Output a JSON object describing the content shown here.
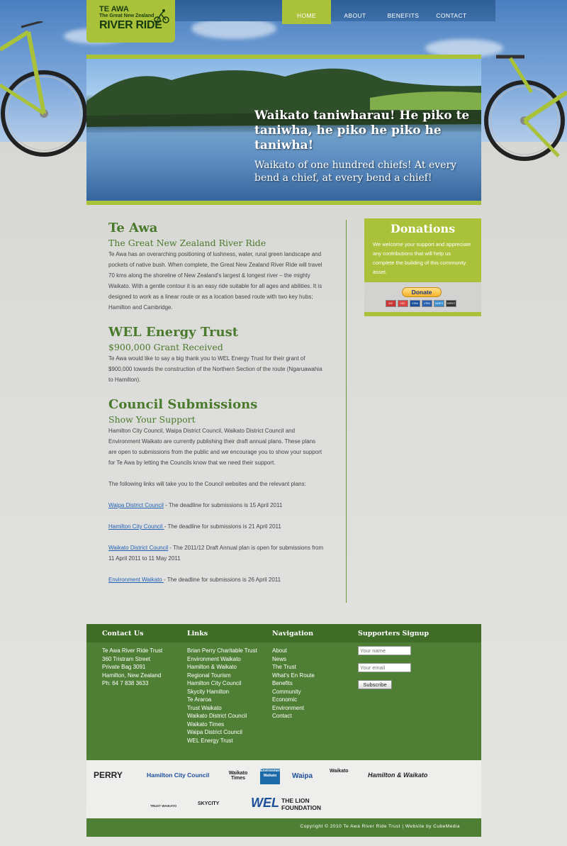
{
  "logo": {
    "line1": "TE AWA",
    "line2": "The Great New Zealand",
    "line3": "RIVER RIDE"
  },
  "nav": [
    {
      "label": "HOME",
      "active": true
    },
    {
      "label": "ABOUT",
      "active": false
    },
    {
      "label": "BENEFITS",
      "active": false
    },
    {
      "label": "CONTACT",
      "active": false
    }
  ],
  "banner": {
    "maori": "Waikato taniwharau! He piko te taniwha, he piko he piko he taniwha!",
    "english": "Waikato of one hundred chiefs! At every bend a chief, at every  bend a chief!"
  },
  "sections": {
    "teawa": {
      "title": "Te Awa",
      "subtitle": "The Great New Zealand River Ride",
      "body": "Te Awa has an overarching positioning of lushness, water, rural green landscape and pockets of native bush. When complete, the Great New Zealand River Ride will travel 70 kms along the shoreline of New Zealand's largest & longest river – the mighty Waikato. With a gentle contour it is an easy ride suitable for all ages and abilities. It is designed to work as a linear route or as a location based route with two key hubs; Hamilton and Cambridge."
    },
    "wel": {
      "title": "WEL Energy Trust",
      "subtitle": "$900,000 Grant Received",
      "body": "Te Awa would like to say a big thank you to WEL Energy Trust for their grant of $900,000 towards the construction of the Northern Section of the route (Ngaruawahia to Hamilton)."
    },
    "council": {
      "title": "Council Submissions",
      "subtitle": "Show Your Support",
      "body": "Hamilton City Council, Waipa District Council, Waikato District Council and Environment Waikato are currently publishing their draft annual plans. These plans are open to submissions from the public and we encourage you to show your support for Te Awa by letting the Councils know that we need their support.",
      "intro": "The following links will take you to the Council websites and the relevant plans:",
      "links": [
        {
          "link": "Waipa District Council",
          "text": " - The deadline for submissions is 15 April 2011"
        },
        {
          "link": "Hamilton City Council ",
          "text": "- The deadline for submissions is 21 April 2011"
        },
        {
          "link": "Waikato District Council",
          "text": " - The 2011/12 Draft Annual plan is open for submissions from 11 April 2011 to 11 May 2011"
        },
        {
          "link": "Environment Waikato ",
          "text": "- The deadline for submissions is 26 April 2011"
        }
      ]
    }
  },
  "donations": {
    "title": "Donations",
    "text": "We welcome your support and appreciate any contributions that will help us complete the building of this community asset.",
    "button": "Donate",
    "cards": [
      "MC",
      "MC",
      "VISA",
      "VISA",
      "AMEX",
      "DEBIT"
    ]
  },
  "footer": {
    "contact": {
      "title": "Contact Us",
      "lines": [
        "Te Awa River Ride Trust",
        "360 Tristram Street",
        "Private Bag 3091",
        "Hamilton, New Zealand",
        "Ph: 64 7 838 3633"
      ]
    },
    "links": {
      "title": "Links",
      "items": [
        "Brian Perry Charitable Trust",
        "Environment Waikato",
        "Hamilton & Waikato Regional Tourism",
        "Hamilton City Council",
        "Skycity Hamilton",
        "Te Araroa",
        "Trust Waikato",
        "Waikato District Council",
        "Waikato Times",
        "Waipa District Council",
        "WEL Energy Trust"
      ]
    },
    "navigation": {
      "title": "Navigation",
      "items": [
        "About",
        "News",
        "The Trust",
        "What's En Route",
        "Benefits",
        "Community",
        "Economic",
        "Environment",
        "Contact"
      ]
    },
    "signup": {
      "title": "Supporters Signup",
      "name_placeholder": "Your name",
      "email_placeholder": "Your email",
      "button": "Subscribe"
    }
  },
  "sponsors": [
    "PERRY",
    "Hamilton City Council",
    "Waikato Times",
    "Environment Waikato",
    "Waipa",
    "Waikato",
    "Hamilton & Waikato",
    "TRUST WAIKATO",
    "SKYCITY",
    "WEL",
    "THE LION FOUNDATION"
  ],
  "copyright": "Copyright © 2010 Te Awa River Ride Trust   |   Website by CubeMedia",
  "colors": {
    "green": "#a9c23a",
    "dark_green": "#4f7f35",
    "heading_green": "#4a7a2c",
    "link_blue": "#2262b5"
  }
}
